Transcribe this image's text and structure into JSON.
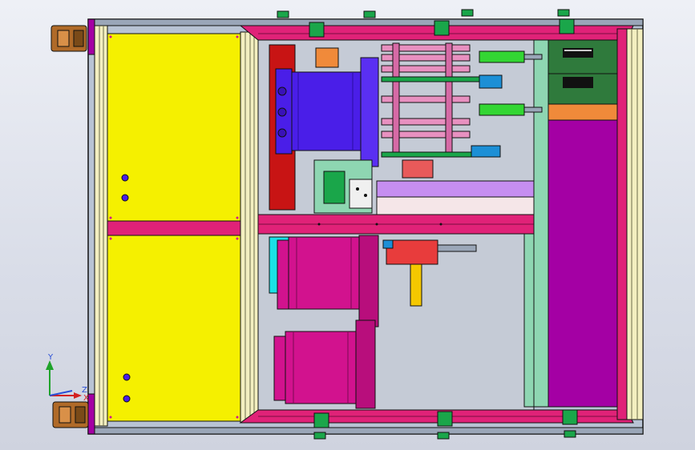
{
  "viewer": {
    "background_top": "#eef0f6",
    "background_bottom": "#cfd3df"
  },
  "triad": {
    "x_label": "X",
    "y_label": "Y",
    "z_label": "Z",
    "colors": {
      "x": "#d32020",
      "y": "#1fa32a",
      "z": "#2a4fd6"
    }
  },
  "model": {
    "colors": {
      "frame_outline": "#1a1a1a",
      "panel_yellow": "#f5f000",
      "rail_cream": "#f3efc0",
      "beam_magenta": "#e02278",
      "purple": "#a400a4",
      "cylinder_blue": "#4a1ee8",
      "cylinder_magenta": "#d2128e",
      "clamp_green": "#1aa64a",
      "copper": "#b06a28",
      "red_block": "#c81414",
      "cyan": "#19e1e6",
      "green_cylinder": "#33d633"
    }
  }
}
